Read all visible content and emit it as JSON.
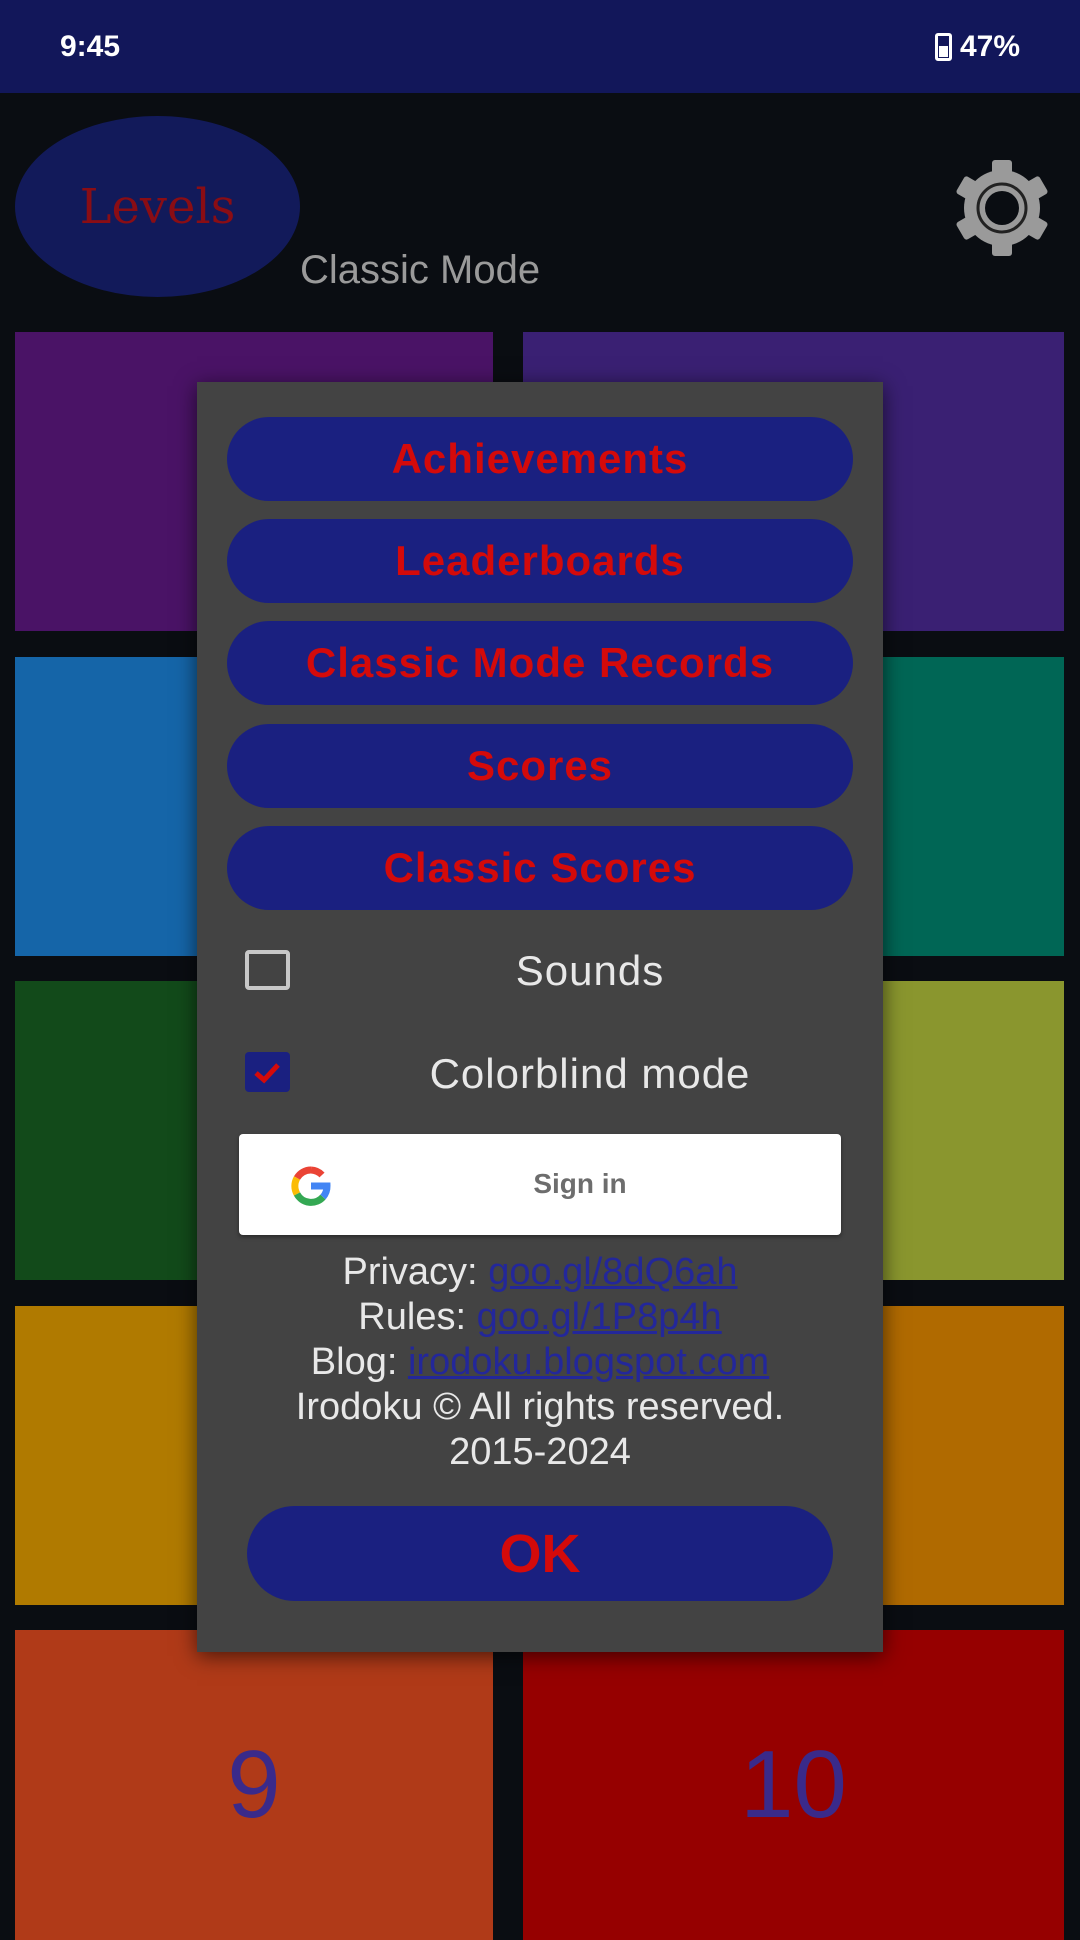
{
  "status_bar": {
    "time": "9:45",
    "battery": "47%"
  },
  "header": {
    "levels_label": "Levels",
    "mode_label": "Classic Mode"
  },
  "tiles": [
    {
      "label": "",
      "color": "#4a1366"
    },
    {
      "label": "",
      "color": "#3a2073"
    },
    {
      "label": "",
      "color": "#1565a8"
    },
    {
      "label": "",
      "color": "#006655"
    },
    {
      "label": "",
      "color": "#124a1a"
    },
    {
      "label": "",
      "color": "#8a962e"
    },
    {
      "label": "",
      "color": "#b07a00"
    },
    {
      "label": "",
      "color": "#b06a00"
    },
    {
      "label": "9",
      "color": "#b03a18"
    },
    {
      "label": "10",
      "color": "#960000"
    }
  ],
  "dialog": {
    "buttons": [
      "Achievements",
      "Leaderboards",
      "Classic Mode Records",
      "Scores",
      "Classic Scores"
    ],
    "sounds": {
      "label": "Sounds",
      "checked": false
    },
    "colorblind": {
      "label": "Colorblind mode",
      "checked": true
    },
    "signin_label": "Sign in",
    "privacy_label": "Privacy:",
    "privacy_link": "goo.gl/8dQ6ah",
    "rules_label": "Rules:",
    "rules_link": "goo.gl/1P8p4h",
    "blog_label": "Blog:",
    "blog_link": "irodoku.blogspot.com",
    "copyright": "Irodoku © All rights reserved.",
    "years": "2015-2024",
    "ok_label": "OK"
  },
  "colors": {
    "accent_button": "#1a2080",
    "button_text": "#d40a0a",
    "dialog_bg": "#434343"
  }
}
